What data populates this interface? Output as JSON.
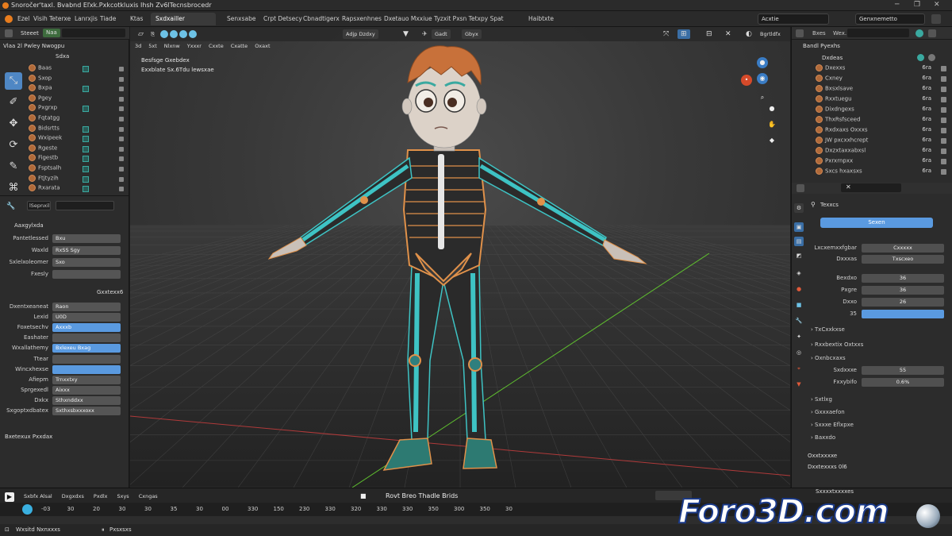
{
  "window": {
    "title": "Snoročer'taxl. Bvabnd Eľxk.Pxkcotkluxis Ihsh Zv6lTecnsbrocedr"
  },
  "menu": [
    "Ezel",
    "Visih",
    "Teterxe",
    "Lanrxjis",
    "Tiade"
  ],
  "workspace_tabs": [
    "Ktas",
    "Sxdxailler",
    "Senxsabe",
    "Crpt Detsecy",
    "Cbnadtigerx",
    "Rapsxenhnes",
    "Dxetauo Mxxiue Tyzxit Pxsn Tetxpy Spat",
    "Haibtxte"
  ],
  "header_right": {
    "scene": "Acxtie",
    "layer": "Genxnemetto"
  },
  "left_panel": {
    "toolbar": {
      "mode": "Steeet",
      "tag": "Naa"
    },
    "outliner_header": "Vlaa 2l Pwley  Nwogpu",
    "outliner_sub": "Sdxa",
    "outliner_items": [
      "Baas",
      "Sxop",
      "Bxpa",
      "Pgey",
      "Pxgrxp",
      "Fqtatgg",
      "Bidsrtts",
      "Wxipeek",
      "Rgeste",
      "Figestb",
      "Fsptsalh",
      "Ftjtyzih",
      "Rxarata"
    ],
    "props_tab": "lSepnxil",
    "props_title": "Aaxgylxda",
    "props": [
      {
        "label": "Pantetlessed",
        "value": "Bxu"
      },
      {
        "label": "Waxld",
        "value": "RxSS Sgy"
      },
      {
        "label": "Sxlelxoleomer",
        "value": "Sxo"
      },
      {
        "label": "Fxesly",
        "value": ""
      }
    ],
    "section2": "Gxxtexx6",
    "props2": [
      {
        "label": "Dxentxeaneat",
        "value": "Raon"
      },
      {
        "label": "Lexid",
        "value": "U0D"
      },
      {
        "label": "Foxetsechv",
        "value": "Axxxb"
      },
      {
        "label": "Eashater",
        "value": ""
      },
      {
        "label": "Wxallathemy",
        "value": "Bxlexeu Bxag"
      },
      {
        "label": "Ttear",
        "value": ""
      },
      {
        "label": "Wincxhexse",
        "value": ""
      },
      {
        "label": "Afiepm",
        "value": "Trnxxtxy"
      },
      {
        "label": "Sprgexedl",
        "value": "Aixxx"
      },
      {
        "label": "Dxkx",
        "value": "Sthxnddxx"
      },
      {
        "label": "Sxgoptxdbatex",
        "value": "Sxthxsbxxxoxx"
      }
    ],
    "footer": "Bxetexux Pxxdax"
  },
  "viewport": {
    "header_buttons": [
      "Gadt",
      "Gbyx",
      "Adjp Dzdxy"
    ],
    "view_menu": [
      "3d",
      "5xt",
      "Nlxnw",
      "Yxxxr",
      "Cxxte",
      "Cxatte",
      "Oxaxt"
    ],
    "overlay_line1": "Besfsge Gxebdex",
    "overlay_line2": "Exxblate Sx.6Tdu lewsxae",
    "right_label": "Bgrtldfx"
  },
  "right_panel": {
    "tabs": [
      "Bxes",
      "Wex."
    ],
    "outliner_title": "Bandl  Pyexhs",
    "root": "Dxdeas",
    "items": [
      {
        "label": "Dxexxs",
        "value": "6ra"
      },
      {
        "label": "Cxney",
        "value": "6ra"
      },
      {
        "label": "Bxsxlsave",
        "value": "6ra"
      },
      {
        "label": "Rxxtuegu",
        "value": "6ra"
      },
      {
        "label": "Dixdngexs",
        "value": "6ra"
      },
      {
        "label": "ThxRsfsceed",
        "value": "6ra"
      },
      {
        "label": "Rxdxaxs Oxxxs",
        "value": "6ra"
      },
      {
        "label": "JW pxcxxhcrept",
        "value": "6ra"
      },
      {
        "label": "Dxzxtaxxabxsl",
        "value": "6ra"
      },
      {
        "label": "Pxrxrnpxx",
        "value": "6ra"
      },
      {
        "label": "Sxcs hxaxsxs",
        "value": "6ra"
      }
    ],
    "props_title": "Texxcs",
    "button": "Sexen",
    "fields": [
      {
        "label": "Lxcxemxxfgbar",
        "value": "Cxxxxx"
      },
      {
        "label": "Dxxxas",
        "value": "Txscxeo"
      },
      {
        "label": "Bexdxo",
        "value": "36"
      },
      {
        "label": "Pxgre",
        "value": "36"
      },
      {
        "label": "Dxxo",
        "value": "26"
      },
      {
        "label": "35",
        "value": ""
      }
    ],
    "sections": [
      "TxCxxkxse",
      "Rxxbextix Oxtxxs",
      "Oxnbcxaxs"
    ],
    "fields2": [
      {
        "label": "Sxdxxxe",
        "value": "55"
      },
      {
        "label": "Fxxybifo",
        "value": "0.6%"
      }
    ],
    "sections2": [
      "Sxtlxg",
      "Gxxxaefon",
      "Sxxxe Eflxpxe",
      "Baxxdo"
    ],
    "bottom1": "Oxxtxxxxe",
    "bottom2": "Dxxtexxxs 0l6",
    "bottom3": "Sxxxxtxxxxes"
  },
  "timeline": {
    "controls": [
      "Sxbfx Alsal",
      "Dxgxdxs",
      "Pxdlx",
      "Sxys",
      "Cxngas"
    ],
    "title": "Rovt Breo Thadle Brids",
    "numbers": [
      "-03",
      "30",
      "20",
      "30",
      "30",
      "35",
      "30",
      "00",
      "330",
      "150",
      "230",
      "330",
      "320",
      "330",
      "330",
      "350",
      "300",
      "350",
      "30"
    ],
    "status": "Wxsitd Nxnxxxs",
    "status2": "Pxsxsxs"
  },
  "watermark": "Foro3D.com"
}
